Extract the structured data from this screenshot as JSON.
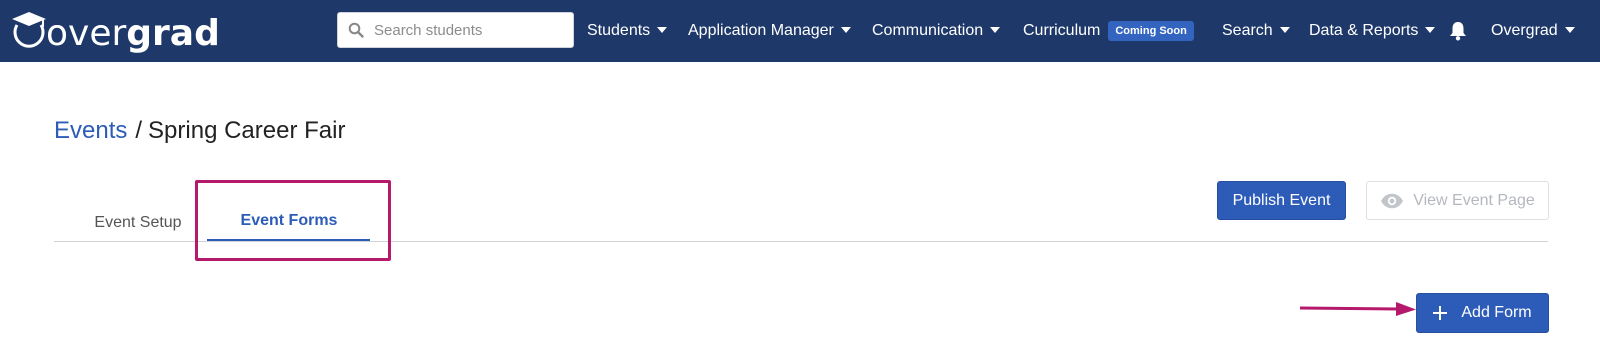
{
  "navbar": {
    "logo_text_thin": "over",
    "logo_text_bold": "grad",
    "search_placeholder": "Search students",
    "items": [
      {
        "label": "Students"
      },
      {
        "label": "Application Manager"
      },
      {
        "label": "Communication"
      },
      {
        "label": "Curriculum",
        "badge": "Coming Soon"
      },
      {
        "label": "Search"
      },
      {
        "label": "Data & Reports"
      },
      {
        "label": "Overgrad"
      }
    ],
    "background_color": "#1d3869"
  },
  "breadcrumb": {
    "parent": "Events",
    "separator": "/",
    "current": "Spring Career Fair"
  },
  "tabs": [
    {
      "label": "Event Setup",
      "active": false
    },
    {
      "label": "Event Forms",
      "active": true
    }
  ],
  "actions": {
    "publish_label": "Publish Event",
    "view_label": "View Event Page",
    "add_form_label": "Add Form"
  },
  "colors": {
    "accent": "#2d5cb8",
    "annotation": "#b5196c"
  }
}
